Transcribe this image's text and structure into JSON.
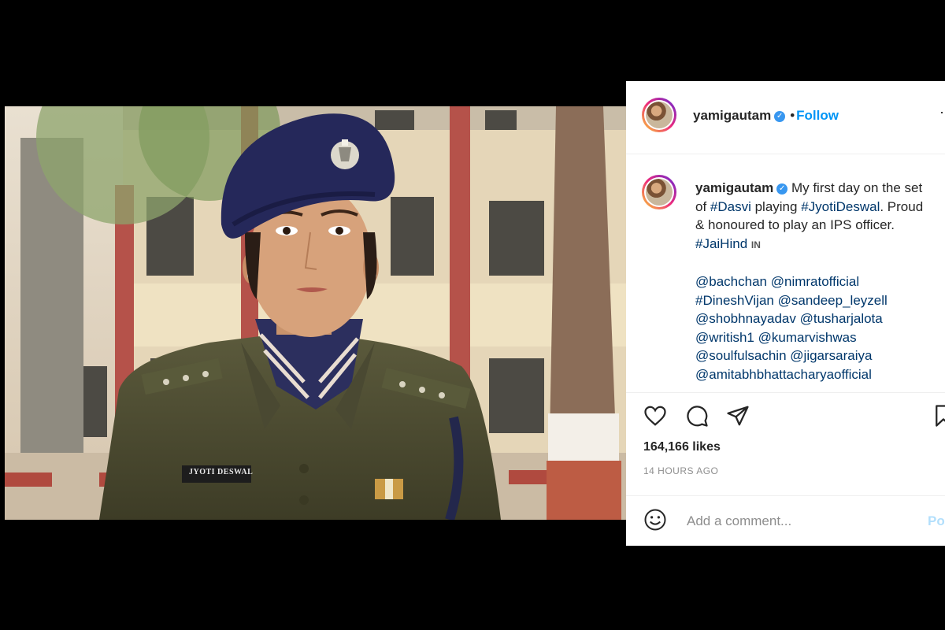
{
  "post": {
    "username": "yamigautam",
    "follow_label": "Follow",
    "separator": "•",
    "more_icon": "more-icon"
  },
  "caption": {
    "username": "yamigautam",
    "text_1": "My first day on the set of ",
    "tag_dasvi": "#Dasvi",
    "text_2": " playing ",
    "tag_jyoti": "#JyotiDeswal",
    "text_3": ". Proud & honoured to play an IPS officer. ",
    "tag_jaihind": "#JaiHind",
    "flag": "IN",
    "mentions": [
      "@bachchan",
      "@nimratofficial",
      "#DineshVijan",
      "@sandeep_leyzell",
      "@shobhnayadav",
      "@tusharjalota",
      "@writish1",
      "@kumarvishwas",
      "@soulfulsachin",
      "@jigarsaraiya",
      "@amitabhbhattacharyaofficial"
    ]
  },
  "photo": {
    "badge_text": "JYOTI DESWAL"
  },
  "stats": {
    "likes": "164,166 likes",
    "time": "14 HOURS AGO"
  },
  "comment": {
    "placeholder": "Add a comment...",
    "post_label": "Po"
  },
  "colors": {
    "accent": "#0095f6",
    "hashtag": "#00376b",
    "post_disabled": "#b2dffc"
  }
}
